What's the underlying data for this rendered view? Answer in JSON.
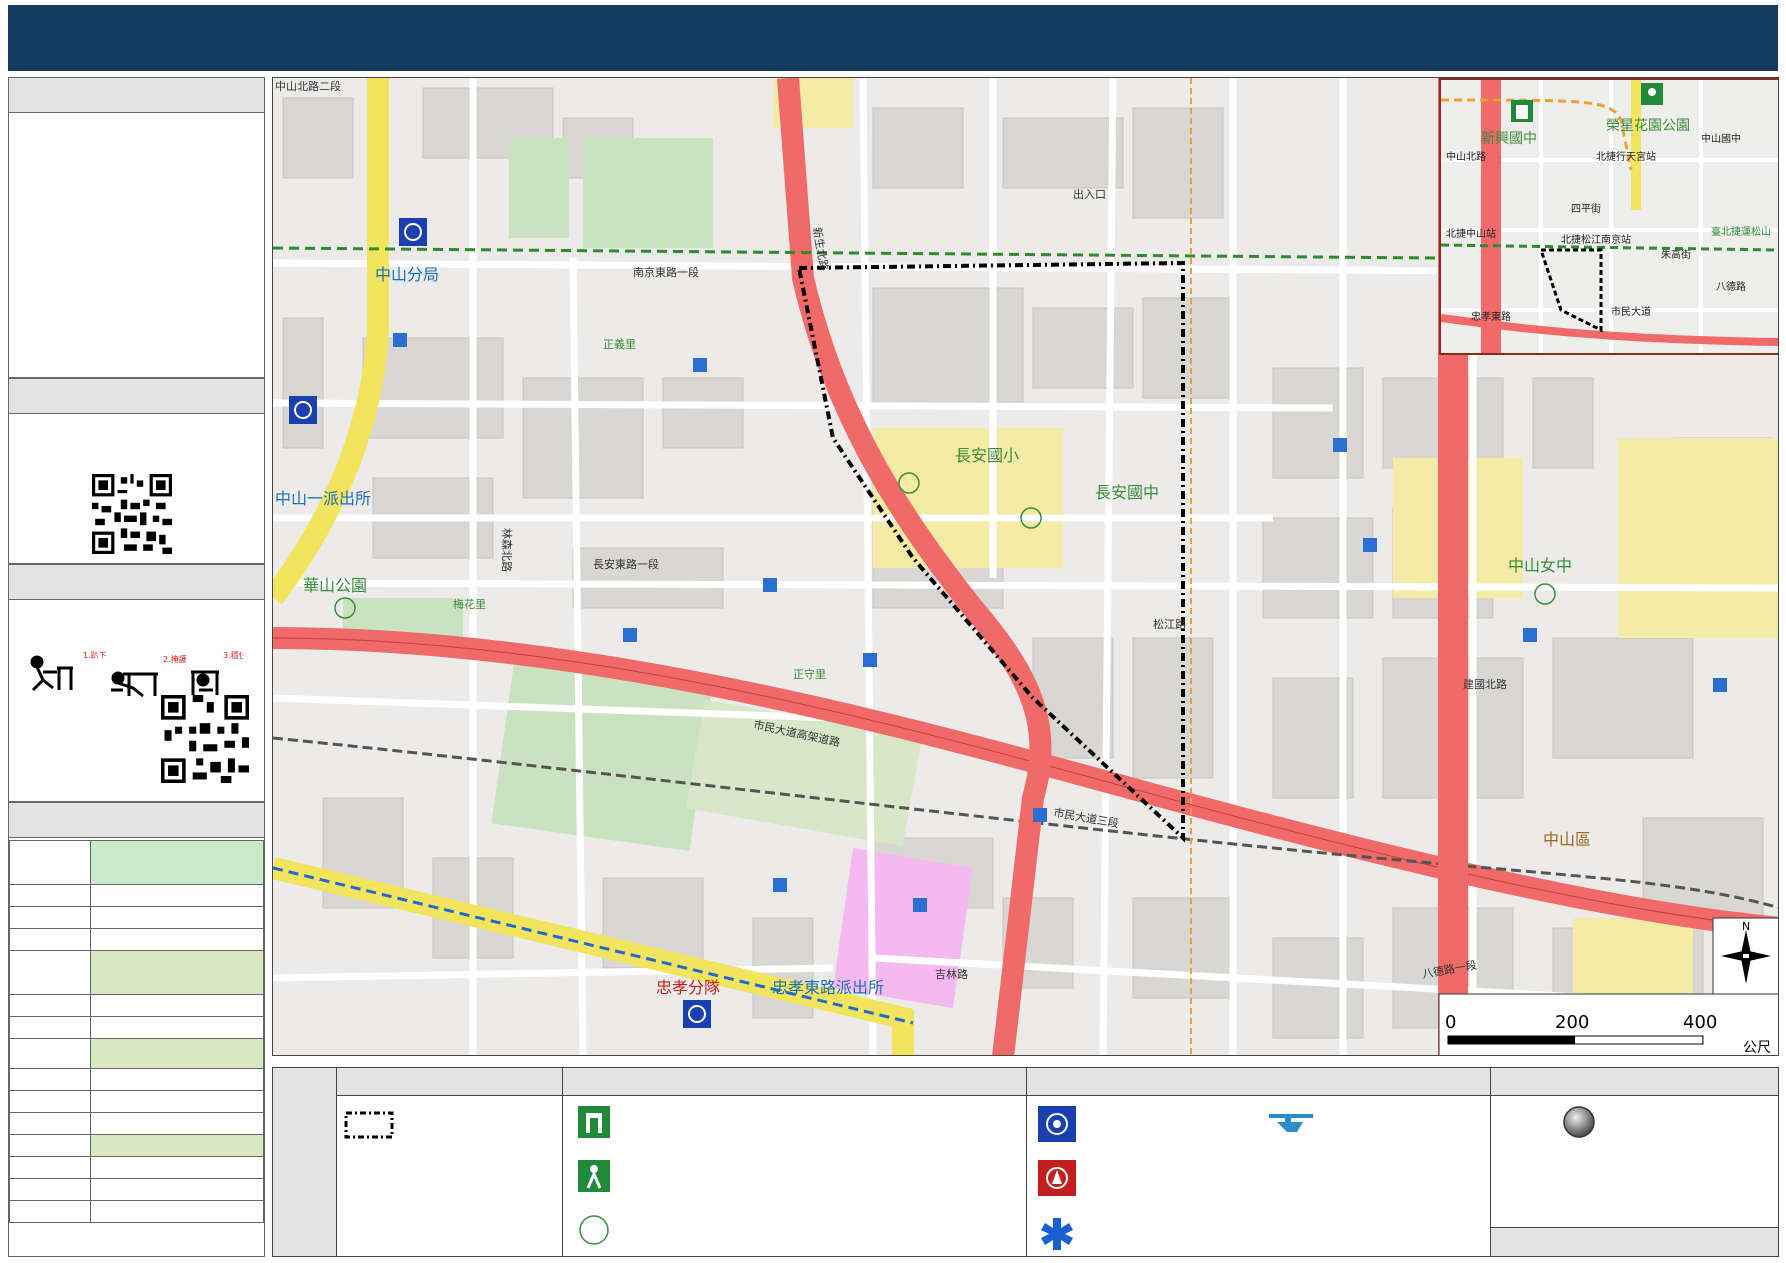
{
  "colors": {
    "banner": "#143a5e",
    "arterial": "#f06a6a",
    "expressway": "#f2e45c",
    "park": "#c9e3c0",
    "school": "#f3eba6",
    "mrt_green": "#2e8b2e",
    "mrt_blue": "#1f6bd1",
    "table_green": "#cbeacb"
  },
  "map": {
    "labels": {
      "zhongshan_branch": "中山分局",
      "zhongshan_1_station": "中山一派出所",
      "huashan_park": "華山公園",
      "changan_elem": "長安國小",
      "changan_jh": "長安國中",
      "zhongshan_girls": "中山女中",
      "zhongxiao_fire": "忠孝分隊",
      "zhongxiao_e_station": "忠孝東路派出所",
      "zhongshan_district": "中山區",
      "nanjing_e_rd": "南京東路一段",
      "changan_e_rd": "長安東路一段",
      "civic_blvd": "市民大道三段",
      "civic_elevated": "市民大道高架道路",
      "bade_rd": "八德路一段",
      "jilin_rd": "吉林路",
      "songjiang_rd": "松江路",
      "jianguo_n_rd": "建國北路",
      "xinsheng_n_rd": "新生北路",
      "linsen_n_rd": "林森北路",
      "zhongshan_n_rd": "中山北路二段",
      "huashan_lbl": "華山公園",
      "meihua_li": "梅花里",
      "zhengyi_li": "正義里",
      "jiayi_li": "正守里",
      "mrt_exit": "出入口"
    },
    "inset_labels": {
      "xinxing_jh": "新興國中",
      "rongxing_park": "榮星花園公園",
      "zhongshan_n_rd": "中山北路",
      "zhongshan_jh": "中山國中",
      "siping_st": "四平街",
      "nanjing_songjiang": "北捷松江南京站",
      "zhongshan_station": "北捷中山站",
      "songshan_line": "臺北捷運松山",
      "minzu_tianmu": "北捷行天宮站",
      "zhongxiao_e": "忠孝東路",
      "zhuhua_st": "朱高街",
      "bade": "八德路",
      "civic": "市民大道"
    },
    "scale": {
      "zero": "0",
      "mid": "200",
      "max": "400",
      "unit": "公尺"
    },
    "north": "N"
  },
  "side_table": {
    "row_count": 15
  }
}
